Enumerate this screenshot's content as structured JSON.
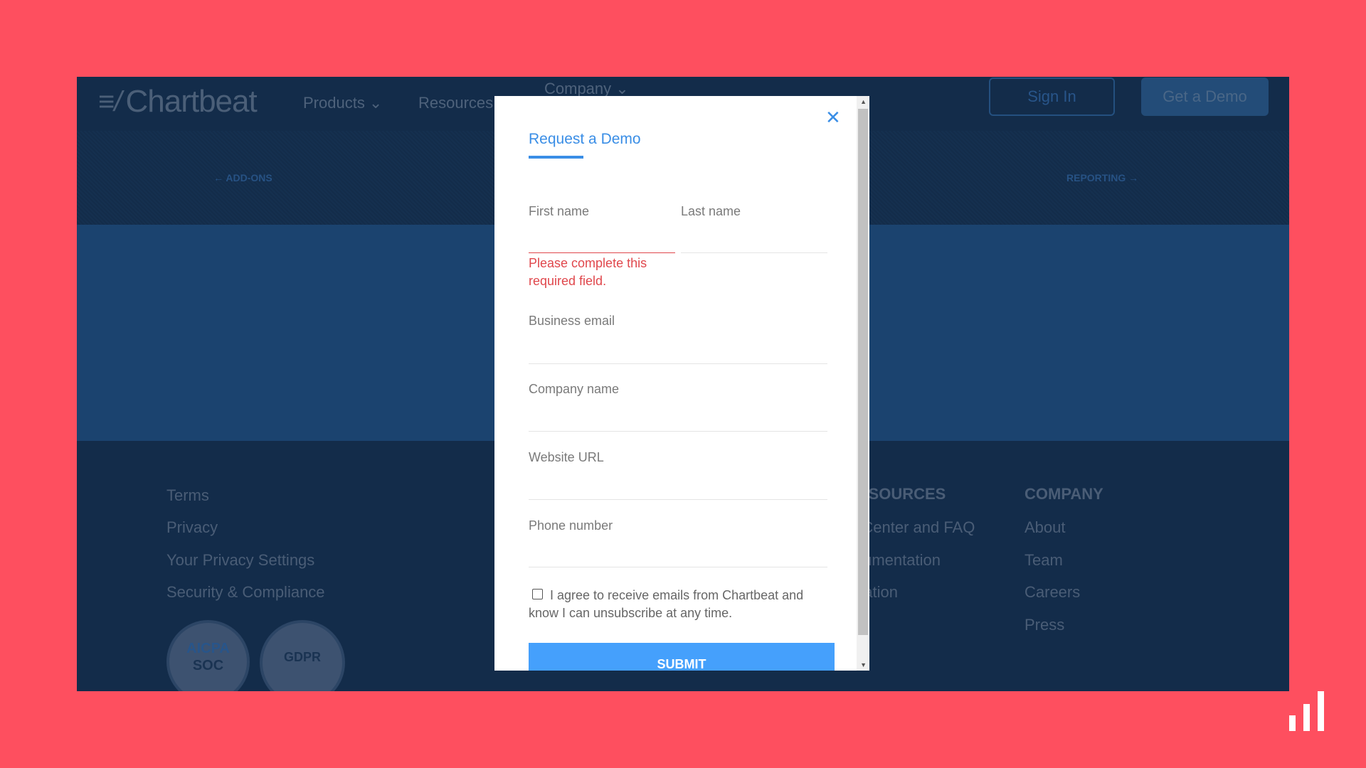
{
  "nav": {
    "logo": "Chartbeat",
    "items": [
      "Products ⌄",
      "Resources ⌄",
      "Company ⌄"
    ],
    "sign_in": "Sign In",
    "get_demo": "Get a Demo"
  },
  "hero": {
    "prev": "← ADD-ONS",
    "next": "REPORTING →"
  },
  "footer": {
    "legal": [
      "Terms",
      "Privacy",
      "Your Privacy Settings",
      "Security & Compliance"
    ],
    "resources": {
      "heading": "RESOURCES",
      "items": [
        "Help Center and FAQ",
        "Documentation",
        "Integration"
      ]
    },
    "company": {
      "heading": "COMPANY",
      "items": [
        "About",
        "Team",
        "Careers",
        "Press"
      ]
    },
    "badges": {
      "aicpa": "AICPA",
      "soc": "SOC",
      "gdpr": "GDPR"
    }
  },
  "modal": {
    "title": "Request a Demo",
    "close": "✕",
    "fields": {
      "first_name": "First name",
      "last_name": "Last name",
      "email": "Business email",
      "company": "Company name",
      "website": "Website URL",
      "phone": "Phone number"
    },
    "error": "Please complete this required field.",
    "consent": "I agree to receive emails from Chartbeat and know I can unsubscribe at any time.",
    "submit": "SUBMIT"
  },
  "colors": {
    "background": "#fe4f5f",
    "accent": "#3a8ee6",
    "submit": "#45a0fc",
    "error": "#e0474c"
  }
}
